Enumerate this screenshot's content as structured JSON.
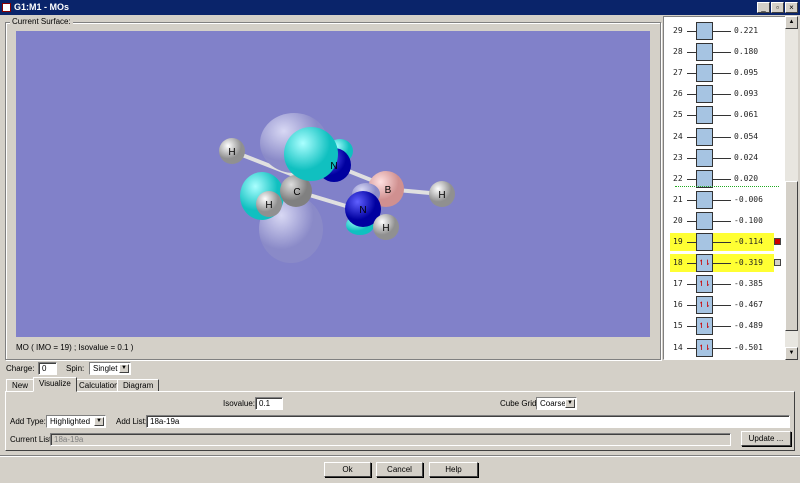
{
  "window": {
    "title": "G1:M1 - MOs",
    "controls": [
      "_",
      "▫",
      "×"
    ]
  },
  "surface": {
    "group_label": "Current Surface:",
    "status": "MO ( IMO = 19) ; Isovalue = 0.1 )",
    "background": "#8181c9",
    "atoms": [
      "H",
      "H",
      "C",
      "N",
      "N",
      "B",
      "H",
      "H"
    ]
  },
  "mo_list": {
    "orbitals": [
      {
        "n": "29",
        "e": "0.221",
        "occ": ""
      },
      {
        "n": "28",
        "e": "0.180",
        "occ": ""
      },
      {
        "n": "27",
        "e": "0.095",
        "occ": ""
      },
      {
        "n": "26",
        "e": "0.093",
        "occ": ""
      },
      {
        "n": "25",
        "e": "0.061",
        "occ": ""
      },
      {
        "n": "24",
        "e": "0.054",
        "occ": ""
      },
      {
        "n": "23",
        "e": "0.024",
        "occ": ""
      },
      {
        "n": "22",
        "e": "0.020",
        "occ": ""
      },
      {
        "n": "21",
        "e": "-0.006",
        "occ": ""
      },
      {
        "n": "20",
        "e": "-0.100",
        "occ": ""
      },
      {
        "n": "19",
        "e": "-0.114",
        "occ": "",
        "highlight": true,
        "marker": "#cc0000"
      },
      {
        "n": "18",
        "e": "-0.319",
        "occ": "↿⇂",
        "highlight": true,
        "marker": "#d4d0c8"
      },
      {
        "n": "17",
        "e": "-0.385",
        "occ": "↿⇂"
      },
      {
        "n": "16",
        "e": "-0.467",
        "occ": "↿⇂"
      },
      {
        "n": "15",
        "e": "-0.489",
        "occ": "↿⇂"
      },
      {
        "n": "14",
        "e": "-0.501",
        "occ": "↿⇂"
      }
    ],
    "homo_lumo_separator_color": "#22aa22"
  },
  "charge": {
    "label": "Charge:",
    "value": "0"
  },
  "spin": {
    "label": "Spin:",
    "value": "Singlet"
  },
  "tabs": [
    {
      "label": "New"
    },
    {
      "label": "Visualize",
      "active": true
    },
    {
      "label": "Calculation"
    },
    {
      "label": "Diagram"
    }
  ],
  "visualize": {
    "isovalue_label": "Isovalue:",
    "isovalue": "0.1",
    "cube_grid_label": "Cube Grid:",
    "cube_grid": "Coarse",
    "add_type_label": "Add Type:",
    "add_type": "Highlighted",
    "add_list_label": "Add List:",
    "add_list": "18a-19a",
    "current_list_label": "Current List:",
    "current_list": "18a-19a",
    "update_label": "Update ..."
  },
  "buttons": {
    "ok": "Ok",
    "cancel": "Cancel",
    "help": "Help"
  }
}
